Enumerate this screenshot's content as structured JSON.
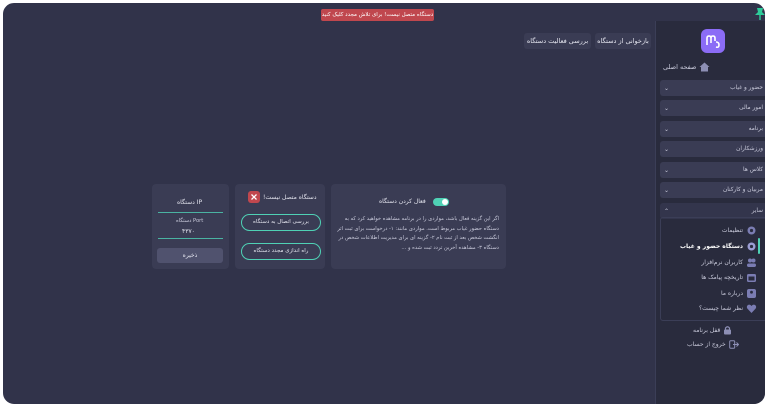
{
  "alert": {
    "text": "دستگاه متصل نیست! برای تلاش مجدد کلیک کنید"
  },
  "sidebar": {
    "home": "صفحه اصلی",
    "groups": [
      {
        "label": "حضور و غیاب"
      },
      {
        "label": "امور مالی"
      },
      {
        "label": "برنامه"
      },
      {
        "label": "ورزشکاران"
      },
      {
        "label": "کلاس ها"
      },
      {
        "label": "مربیان و کارکنان"
      },
      {
        "label": "سایر"
      }
    ],
    "submenu": [
      {
        "label": "تنظیمات"
      },
      {
        "label": "دستگاه حضور و غیاب"
      },
      {
        "label": "کاربران نرم‌افزار"
      },
      {
        "label": "تاریخچه پیامک ها"
      },
      {
        "label": "درباره ما"
      },
      {
        "label": "نظر شما چیست؟"
      }
    ],
    "lock": "قفل برنامه",
    "logout": "خروج از حساب"
  },
  "toolbar": {
    "reload": "بازخوانی از دستگاه",
    "check_activity": "بررسی فعالیت دستگاه"
  },
  "enable_card": {
    "title": "فعال کردن دستگاه",
    "toggle_on": true,
    "description": "اگر این گزینه فعال باشد، مواردی را در برنامه مشاهده خواهید کرد که به دستگاه حضور غیاب مربوط است. مواردی مانند: ۱- درخواست برای ثبت اثر انگشت شخص بعد از ثبت نام ۲- گزینه ای برای مدیریت اطلاعات شخص در دستگاه ۳- مشاهده آخرین تردد ثبت شده و ..."
  },
  "status_card": {
    "title": "دستگاه متصل نیست!",
    "check_connection": "بررسی اتصال به دستگاه",
    "restart": "راه اندازی مجدد دستگاه"
  },
  "ip_card": {
    "title": "IP دستگاه",
    "port_label": "Port دستگاه",
    "port_value": "۴۳۷۰",
    "save": "ذخیره"
  },
  "colors": {
    "background": "#31334a",
    "sidebar": "#292b3d",
    "card": "#3a3c54",
    "accent": "#4fd1b5",
    "alert": "#c0474e",
    "brand": "#8b6cf6"
  }
}
